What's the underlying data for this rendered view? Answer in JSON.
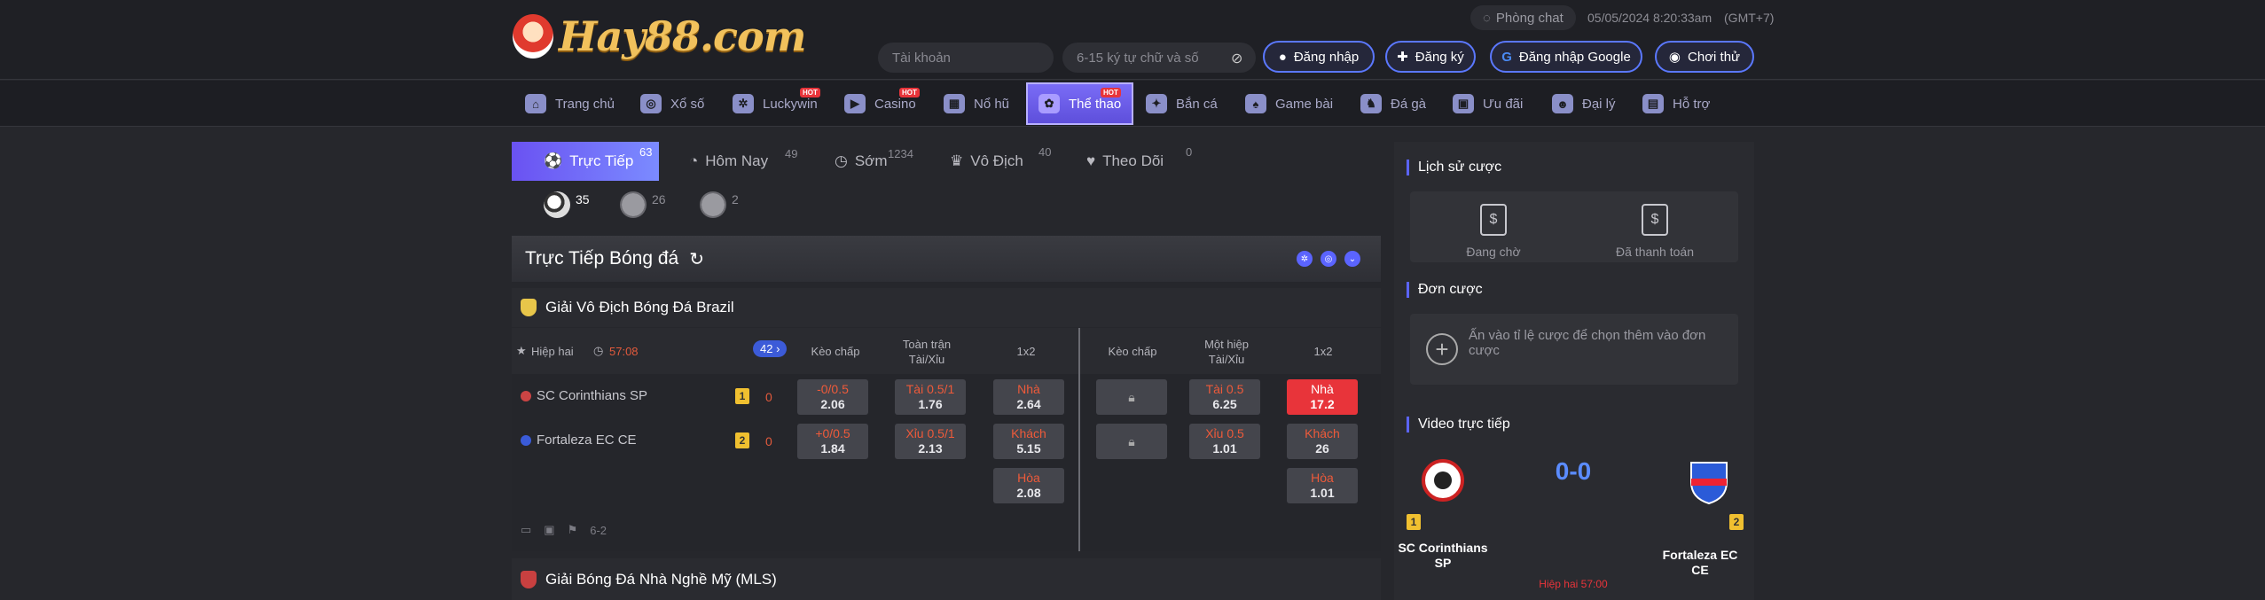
{
  "header": {
    "logo_text": "Hay88.com",
    "chat_label": "Phòng chat",
    "datetime": "05/05/2024 8:20:33am",
    "timezone": "(GMT+7)",
    "account_placeholder": "Tài khoản",
    "password_placeholder": "6-15 ký tự chữ và số",
    "buttons": {
      "login": "Đăng nhập",
      "register": "Đăng ký",
      "google": "Đăng nhập Google",
      "trial": "Chơi thử"
    }
  },
  "nav": [
    {
      "label": "Trang chủ",
      "icon": "home-icon"
    },
    {
      "label": "Xổ số",
      "icon": "lottery-icon"
    },
    {
      "label": "Luckywin",
      "icon": "luckywin-icon",
      "hot": "HOT"
    },
    {
      "label": "Casino",
      "icon": "casino-icon",
      "hot": "HOT"
    },
    {
      "label": "Nổ hũ",
      "icon": "slots-icon"
    },
    {
      "label": "Thể thao",
      "icon": "sports-icon",
      "hot": "HOT",
      "active": true
    },
    {
      "label": "Bắn cá",
      "icon": "fish-icon"
    },
    {
      "label": "Game bài",
      "icon": "cards-icon"
    },
    {
      "label": "Đá gà",
      "icon": "cockfight-icon"
    },
    {
      "label": "Ưu đãi",
      "icon": "gift-icon"
    },
    {
      "label": "Đại lý",
      "icon": "agent-icon"
    },
    {
      "label": "Hỗ trợ",
      "icon": "support-icon"
    }
  ],
  "tabs": [
    {
      "label": "Trực Tiếp",
      "count": "63"
    },
    {
      "label": "Hôm Nay",
      "count": "49"
    },
    {
      "label": "Sớm",
      "count": "1234"
    },
    {
      "label": "Vô Địch",
      "count": "40"
    },
    {
      "label": "Theo Dõi",
      "count": "0"
    }
  ],
  "sports": [
    {
      "icon": "soccer-icon",
      "count": "35"
    },
    {
      "icon": "basketball-icon",
      "count": "26"
    },
    {
      "icon": "volleyball-icon",
      "count": "2"
    }
  ],
  "section_title": "Trực Tiếp Bóng đá",
  "league1": "Giải Vô Địch Bóng Đá Brazil",
  "league2": "Giải Bóng Đá Nhà Nghề Mỹ (MLS)",
  "match": {
    "period": "Hiệp hai",
    "time": "57:08",
    "more_count": "42",
    "cols": [
      "Kèo chấp",
      "Toàn trận Tài/Xỉu",
      "1x2",
      "Kèo chấp",
      "Một hiệp Tài/Xỉu",
      "1x2"
    ],
    "home": {
      "name": "SC Corinthians SP",
      "rank": "1",
      "score": "0"
    },
    "away": {
      "name": "Fortaleza EC CE",
      "rank": "2",
      "score": "0"
    },
    "odds": {
      "hc_home": [
        "-0/0.5",
        "2.06"
      ],
      "hc_away": [
        "+0/0.5",
        "1.84"
      ],
      "ou_home": [
        "Tài 0.5/1",
        "1.76"
      ],
      "ou_away": [
        "Xỉu 0.5/1",
        "2.13"
      ],
      "x12_home": [
        "Nhà",
        "2.64"
      ],
      "x12_away": [
        "Khách",
        "5.15"
      ],
      "x12_draw": [
        "Hòa",
        "2.08"
      ],
      "h1_ou_home": [
        "Tài 0.5",
        "6.25"
      ],
      "h1_ou_away": [
        "Xỉu 0.5",
        "1.01"
      ],
      "h1_x12_home": [
        "Nhà",
        "17.2"
      ],
      "h1_x12_away": [
        "Khách",
        "26"
      ],
      "h1_x12_draw": [
        "Hòa",
        "1.01"
      ]
    },
    "footer_extra": "6-2"
  },
  "right": {
    "history_title": "Lịch sử cược",
    "pending": "Đang chờ",
    "paid": "Đã thanh toán",
    "betslip_title": "Đơn cược",
    "betslip_msg": "Ấn vào tỉ lệ cược để chọn thêm vào đơn cược",
    "video_title": "Video trực tiếp",
    "score": "0-0",
    "home_name": "SC Corinthians SP",
    "away_name": "Fortaleza EC CE",
    "home_rank": "1",
    "away_rank": "2",
    "live_time": "Hiệp hai  57:00"
  }
}
